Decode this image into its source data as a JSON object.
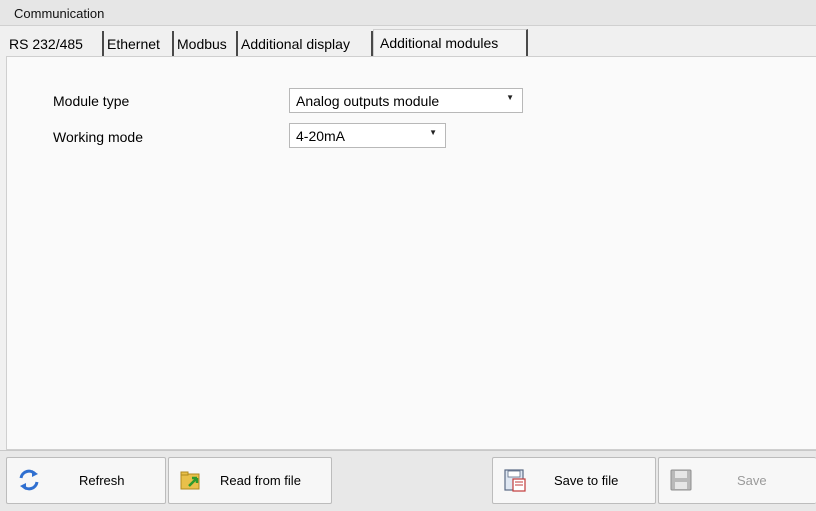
{
  "window": {
    "title": "Communication"
  },
  "tabs": [
    {
      "label": "RS 232/485"
    },
    {
      "label": "Ethernet"
    },
    {
      "label": "Modbus"
    },
    {
      "label": "Additional display"
    },
    {
      "label": "Additional modules",
      "active": true
    }
  ],
  "form": {
    "module_type": {
      "label": "Module type",
      "value": "Analog outputs module"
    },
    "working_mode": {
      "label": "Working mode",
      "value": "4-20mA"
    }
  },
  "buttons": {
    "refresh": {
      "label": "Refresh",
      "icon": "refresh-icon"
    },
    "read_from_file": {
      "label": "Read from file",
      "icon": "folder-open-icon"
    },
    "save_to_file": {
      "label": "Save to file",
      "icon": "save-to-file-icon"
    },
    "save": {
      "label": "Save",
      "icon": "floppy-disk-icon",
      "enabled": false
    }
  },
  "colors": {
    "accent_blue": "#2f6fd0",
    "folder_yellow": "#e9c04a",
    "disabled_text": "#9a9a9a"
  }
}
